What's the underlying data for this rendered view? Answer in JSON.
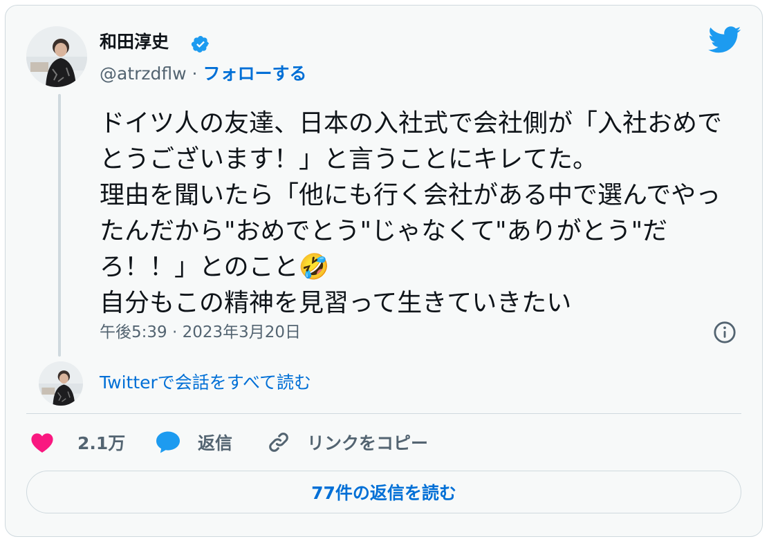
{
  "author": {
    "name": "和田淳史",
    "handle": "@atrzdflw",
    "separator": "·",
    "follow_label": "フォローする",
    "verified_icon": "verified-badge-icon",
    "avatar_icon": "profile-photo"
  },
  "brand": {
    "logo_icon": "twitter-bird-icon",
    "accent_color": "#1d9bf0",
    "link_color": "#006fd6"
  },
  "tweet": {
    "text": "ドイツ人の友達、日本の入社式で会社側が「入社おめでとうございます！」と言うことにキレてた。\n理由を聞いたら「他にも行く会社がある中で選んでやったんだから\"おめでとう\"じゃなくて\"ありがとう\"だろ！！」とのこと🤣\n自分もこの精神を見習って生きていきたい",
    "timestamp": "午後5:39 · 2023年3月20日",
    "info_icon": "info-icon"
  },
  "conversation": {
    "link_label": "Twitterで会話をすべて読む"
  },
  "actions": {
    "like_count": "2.1万",
    "like_color": "#f91880",
    "reply_label": "返信",
    "copy_link_label": "リンクをコピー"
  },
  "footer": {
    "read_replies_label": "77件の返信を読む"
  }
}
